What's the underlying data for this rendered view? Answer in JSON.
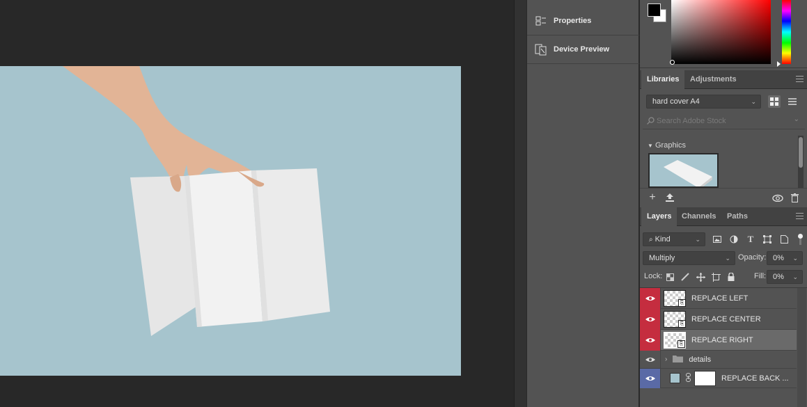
{
  "mid_panel": {
    "items": [
      {
        "label": "Properties",
        "icon": "properties-icon"
      },
      {
        "label": "Device Preview",
        "icon": "device-preview-icon"
      }
    ]
  },
  "color_picker": {
    "foreground": "#000000",
    "background": "#ffffff",
    "hue": "#ff0000"
  },
  "libraries": {
    "tabs": [
      "Libraries",
      "Adjustments"
    ],
    "active_tab": "Libraries",
    "library_select": "hard cover A4",
    "search_placeholder": "Search Adobe Stock",
    "section_label": "Graphics"
  },
  "layers_panel": {
    "tabs": [
      "Layers",
      "Channels",
      "Paths"
    ],
    "active_tab": "Layers",
    "filter_select": "Kind",
    "blend_mode": "Multiply",
    "opacity_label": "Opacity:",
    "opacity_value": "0%",
    "lock_label": "Lock:",
    "fill_label": "Fill:",
    "fill_value": "0%",
    "layers": [
      {
        "name": "REPLACE LEFT",
        "eye_color": "red"
      },
      {
        "name": "REPLACE CENTER",
        "eye_color": "red"
      },
      {
        "name": "REPLACE RIGHT",
        "eye_color": "red",
        "selected": true
      },
      {
        "name": "details",
        "type": "group"
      },
      {
        "name": "REPLACE BACK ...",
        "eye_color": "blue",
        "type": "fill"
      }
    ]
  },
  "colors": {
    "canvas_bg": "#a6c4cd",
    "panel_bg": "#535353",
    "eye_red": "#c52d3f",
    "eye_blue": "#5a6aa6"
  }
}
